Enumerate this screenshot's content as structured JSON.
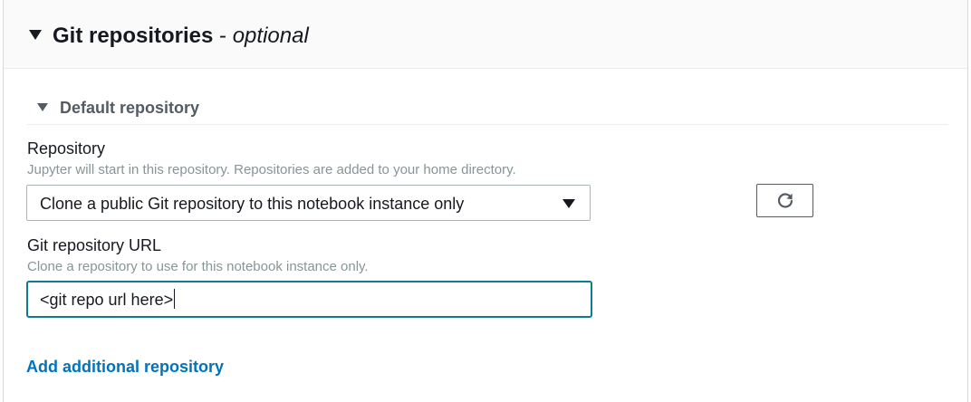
{
  "section": {
    "title": "Git repositories",
    "separator": " - ",
    "optional_label": "optional"
  },
  "subsection": {
    "title": "Default repository"
  },
  "repository_field": {
    "label": "Repository",
    "description": "Jupyter will start in this repository. Repositories are added to your home directory.",
    "selected_value": "Clone a public Git repository to this notebook instance only"
  },
  "url_field": {
    "label": "Git repository URL",
    "description": "Clone a repository to use for this notebook instance only.",
    "value": "<git repo url here>"
  },
  "add_link": {
    "label": "Add additional repository"
  },
  "icons": {
    "section_toggle": "caret-down-icon",
    "subsection_toggle": "caret-down-icon",
    "select_dropdown": "caret-down-icon",
    "refresh": "refresh-icon"
  },
  "colors": {
    "link": "#0073bb",
    "focus_border": "#0d7c8e",
    "muted_text": "#879596"
  }
}
